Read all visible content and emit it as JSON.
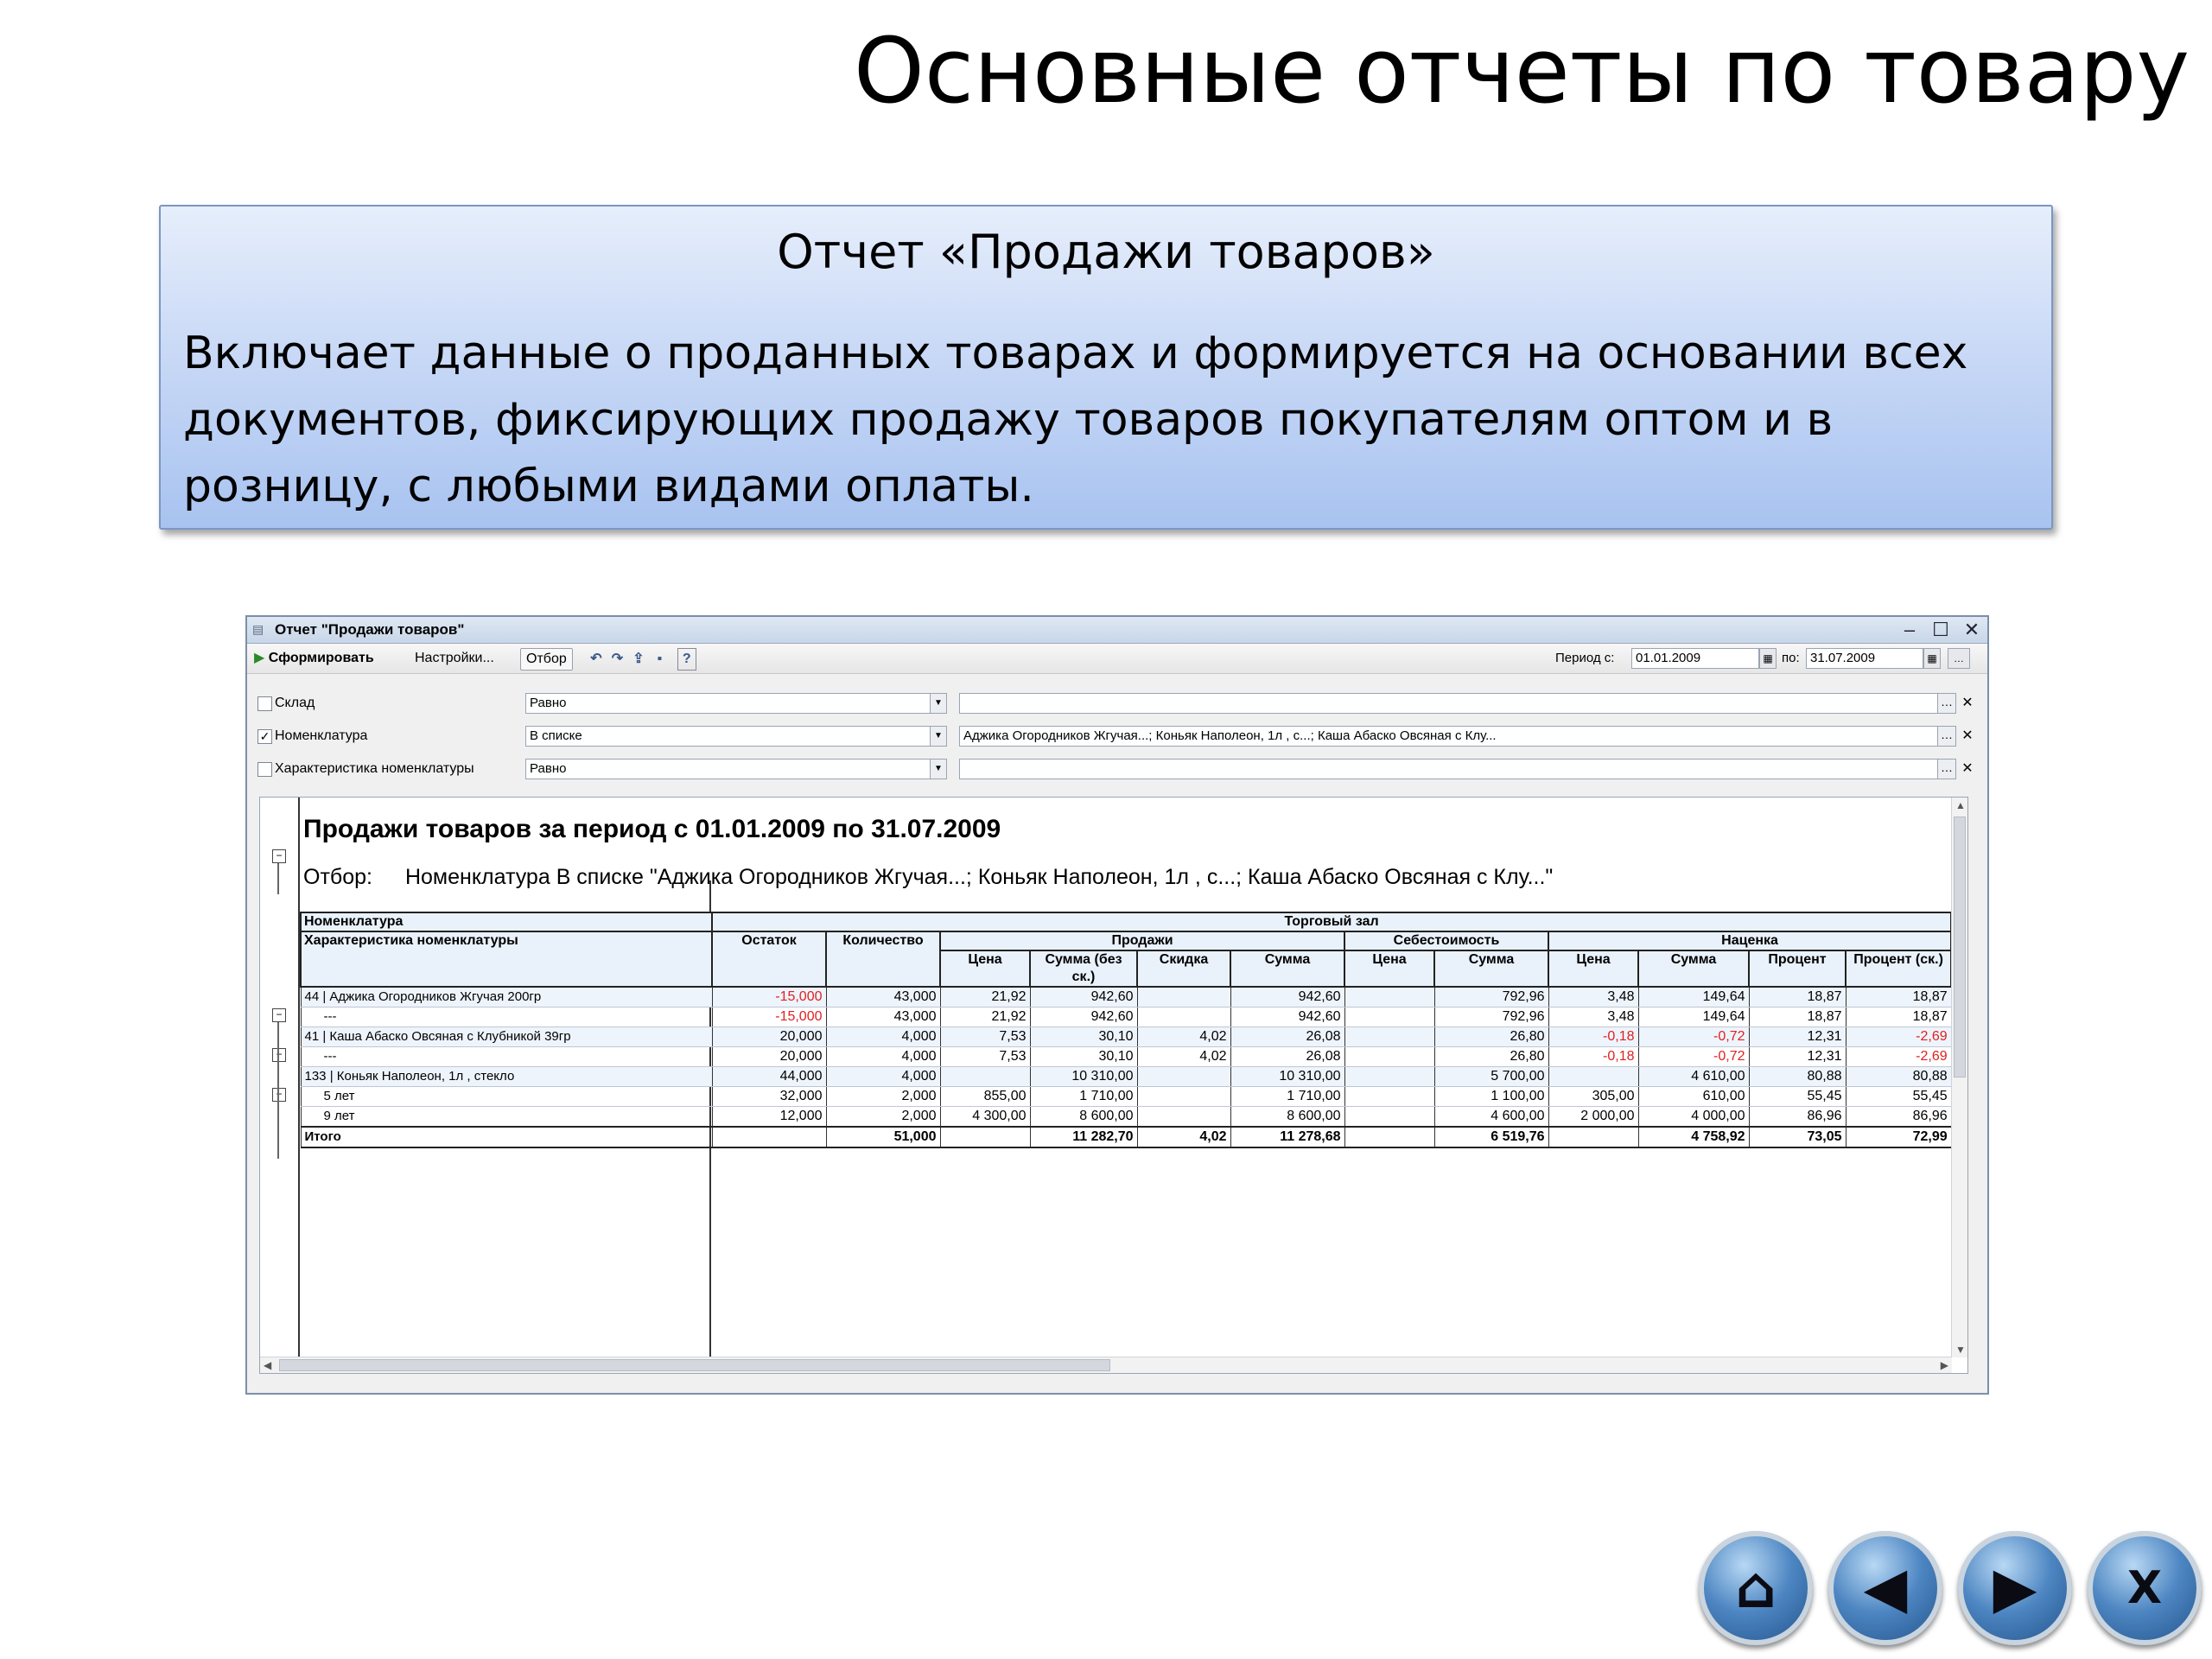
{
  "slide": {
    "title": "Основные отчеты по товару",
    "box_heading": "Отчет «Продажи товаров»",
    "box_text": "Включает данные о проданных товарах и формируется на основании всех документов, фиксирующих продажу товаров покупателям оптом и в розницу, с любыми видами оплаты."
  },
  "window": {
    "title": "Отчет \"Продажи товаров\"",
    "toolbar": {
      "generate": "Сформировать",
      "settings": "Настройки...",
      "filter": "Отбор",
      "period_from_label": "Период с:",
      "period_from": "01.01.2009",
      "period_to_label": "по:",
      "period_to": "31.07.2009"
    },
    "filters": [
      {
        "checked": false,
        "label": "Склад",
        "condition": "Равно",
        "value": ""
      },
      {
        "checked": true,
        "label": "Номенклатура",
        "condition": "В списке",
        "value": "Аджика Огородников Жгучая...; Коньяк  Наполеон,  1л , с...; Каша Абаско Овсяная с Клу..."
      },
      {
        "checked": false,
        "label": "Характеристика номенклатуры",
        "condition": "Равно",
        "value": ""
      }
    ]
  },
  "report": {
    "title": "Продажи товаров за период с 01.01.2009 по 31.07.2009",
    "filter_label": "Отбор:",
    "filter_value": "Номенклатура В списке \"Аджика Огородников Жгучая...; Коньяк  Наполеон,  1л , с...; Каша Абаско Овсяная с Клу...\"",
    "headers": {
      "nomenclature": "Номенклатура",
      "characteristic": "Характеристика номенклатуры",
      "trade_hall": "Торговый зал",
      "remainder": "Остаток",
      "quantity": "Количество",
      "sales": "Продажи",
      "cost": "Себестоимость",
      "markup": "Наценка",
      "price": "Цена",
      "sum_no_disc": "Сумма (без ск.)",
      "discount": "Скидка",
      "sum": "Сумма",
      "percent": "Процент",
      "percent_disc": "Процент (ск.)"
    },
    "rows": [
      {
        "name": "44 | Аджика Огородников Жгучая 200гр",
        "rem": "-15,000",
        "qty": "43,000",
        "price": "21,92",
        "sum_nd": "942,60",
        "disc": "",
        "sum": "942,60",
        "cost_price": "",
        "cost_sum": "792,96",
        "m_price": "3,48",
        "m_sum": "149,64",
        "pct": "18,87",
        "pct_d": "18,87",
        "level": 1
      },
      {
        "name": "---",
        "rem": "-15,000",
        "qty": "43,000",
        "price": "21,92",
        "sum_nd": "942,60",
        "disc": "",
        "sum": "942,60",
        "cost_price": "",
        "cost_sum": "792,96",
        "m_price": "3,48",
        "m_sum": "149,64",
        "pct": "18,87",
        "pct_d": "18,87",
        "level": 2
      },
      {
        "name": "41 | Каша Абаско Овсяная с Клубникой 39гр",
        "rem": "20,000",
        "qty": "4,000",
        "price": "7,53",
        "sum_nd": "30,10",
        "disc": "4,02",
        "sum": "26,08",
        "cost_price": "",
        "cost_sum": "26,80",
        "m_price": "-0,18",
        "m_sum": "-0,72",
        "pct": "12,31",
        "pct_d": "-2,69",
        "level": 1
      },
      {
        "name": "---",
        "rem": "20,000",
        "qty": "4,000",
        "price": "7,53",
        "sum_nd": "30,10",
        "disc": "4,02",
        "sum": "26,08",
        "cost_price": "",
        "cost_sum": "26,80",
        "m_price": "-0,18",
        "m_sum": "-0,72",
        "pct": "12,31",
        "pct_d": "-2,69",
        "level": 2
      },
      {
        "name": "133 | Коньяк  Наполеон,  1л , стекло",
        "rem": "44,000",
        "qty": "4,000",
        "price": "",
        "sum_nd": "10 310,00",
        "disc": "",
        "sum": "10 310,00",
        "cost_price": "",
        "cost_sum": "5 700,00",
        "m_price": "",
        "m_sum": "4 610,00",
        "pct": "80,88",
        "pct_d": "80,88",
        "level": 1
      },
      {
        "name": "5 лет",
        "rem": "32,000",
        "qty": "2,000",
        "price": "855,00",
        "sum_nd": "1 710,00",
        "disc": "",
        "sum": "1 710,00",
        "cost_price": "",
        "cost_sum": "1 100,00",
        "m_price": "305,00",
        "m_sum": "610,00",
        "pct": "55,45",
        "pct_d": "55,45",
        "level": 2
      },
      {
        "name": "9 лет",
        "rem": "12,000",
        "qty": "2,000",
        "price": "4 300,00",
        "sum_nd": "8 600,00",
        "disc": "",
        "sum": "8 600,00",
        "cost_price": "",
        "cost_sum": "4 600,00",
        "m_price": "2 000,00",
        "m_sum": "4 000,00",
        "pct": "86,96",
        "pct_d": "86,96",
        "level": 2
      }
    ],
    "total": {
      "name": "Итого",
      "rem": "",
      "qty": "51,000",
      "price": "",
      "sum_nd": "11 282,70",
      "disc": "4,02",
      "sum": "11 278,68",
      "cost_price": "",
      "cost_sum": "6 519,76",
      "m_price": "",
      "m_sum": "4 758,92",
      "pct": "73,05",
      "pct_d": "72,99"
    }
  },
  "nav": {
    "home": "home-icon",
    "back": "arrow-left-icon",
    "forward": "arrow-right-icon",
    "close": "close-icon",
    "close_glyph": "X"
  },
  "colors": {
    "box_top": "#e6eefb",
    "box_bottom": "#a8c3f0",
    "negative": "#e02020",
    "nav_blue": "#4d86c2"
  }
}
